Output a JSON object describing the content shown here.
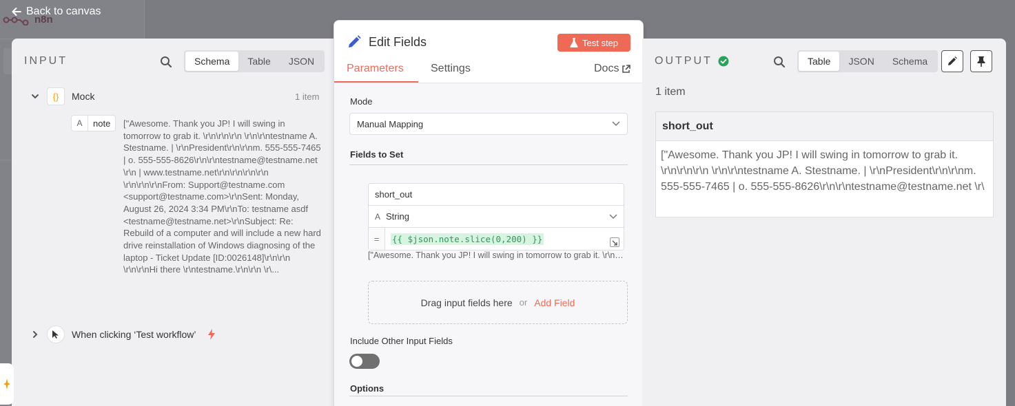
{
  "nav": {
    "back_label": "Back to canvas",
    "logo": "n8n"
  },
  "input": {
    "title": "INPUT",
    "view_tabs": [
      "Schema",
      "Table",
      "JSON"
    ],
    "active_tab": "Schema",
    "node_mock": {
      "name": "Mock",
      "count": "1 item"
    },
    "field": {
      "name": "note",
      "value": "[\"Awesome. Thank you JP! I will swing in tomorrow to grab it. \\r\\n\\r\\n\\r\\n \\r\\n\\r\\ntestname A. Stestname. | \\r\\nPresident\\r\\n\\r\\nm. 555-555-7465 | o. 555-555-8626\\r\\n\\r\\ntestname@testname.net \\r\\n | www.testname.net\\r\\n\\r\\n\\r\\n\\r\\n \\r\\n\\r\\n\\r\\nFrom: Support@testname.com <support@testname.com>\\r\\nSent: Monday, August 26, 2024 3:34 PM\\r\\nTo: testname asdf <testname@testname.net>\\r\\nSubject: Re: Rebuild of a computer and will include a new hard drive reinstallation of Windows diagnosing of the laptop - Ticket Update [ID:0026148]\\r\\n\\r\\n \\r\\n\\r\\nHi there \\r\\ntestname.\\r\\n\\r\\n \\r\\..."
    },
    "node_trigger": {
      "name": "When clicking ‘Test workflow’"
    }
  },
  "editor": {
    "title": "Edit Fields",
    "test_button": "Test step",
    "tabs": {
      "parameters": "Parameters",
      "settings": "Settings",
      "docs": "Docs"
    },
    "mode_label": "Mode",
    "mode_value": "Manual Mapping",
    "fields_to_set_label": "Fields to Set",
    "assignment": {
      "name": "short_out",
      "type": "String",
      "expression": "{{ $json.note.slice(0,200) }}",
      "preview": "[\"Awesome. Thank you JP! I will swing in tomorrow to grab it. \\r\\n\\r\\n\\r\\n"
    },
    "drop_text": "Drag input fields here",
    "drop_or": "or",
    "add_field": "Add Field",
    "include_other_label": "Include Other Input Fields",
    "options_label": "Options"
  },
  "output": {
    "title": "OUTPUT",
    "view_tabs": [
      "Table",
      "JSON",
      "Schema"
    ],
    "active_tab": "Table",
    "count": "1 item",
    "column": "short_out",
    "value": "[\"Awesome. Thank you JP! I will swing in tomorrow to grab it. \\r\\n\\r\\n\\r\\n \\r\\n\\r\\ntestname A. Stestname. | \\r\\nPresident\\r\\n\\r\\nm. 555-555-7465   |   o. 555-555-8626\\r\\n\\r\\ntestname@testname.net  \\r\\"
  },
  "colors": {
    "accent": "#ef6a56",
    "success": "#29a35a",
    "panel_bg": "#f0f0f3"
  }
}
